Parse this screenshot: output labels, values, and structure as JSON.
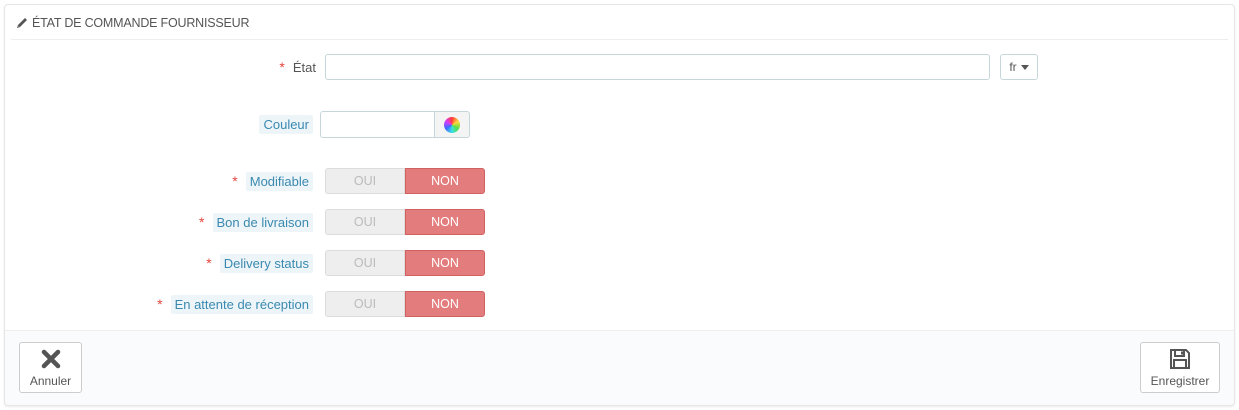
{
  "panel": {
    "title": "ÉTAT DE COMMANDE FOURNISSEUR",
    "title_icon": "pencil-icon"
  },
  "form": {
    "state": {
      "required_mark": "*",
      "label": "État",
      "value": "",
      "lang": "fr"
    },
    "color": {
      "label": "Couleur",
      "value": "",
      "picker_icon": "color-wheel-icon"
    },
    "toggles": [
      {
        "required_mark": "*",
        "label": "Modifiable",
        "yes": "OUI",
        "no": "NON",
        "selected": "NON"
      },
      {
        "required_mark": "*",
        "label": "Bon de livraison",
        "yes": "OUI",
        "no": "NON",
        "selected": "NON"
      },
      {
        "required_mark": "*",
        "label": "Delivery status",
        "yes": "OUI",
        "no": "NON",
        "selected": "NON"
      },
      {
        "required_mark": "*",
        "label": "En attente de réception",
        "yes": "OUI",
        "no": "NON",
        "selected": "NON"
      }
    ]
  },
  "footer": {
    "cancel": {
      "label": "Annuler",
      "icon": "close-icon"
    },
    "save": {
      "label": "Enregistrer",
      "icon": "save-icon"
    }
  },
  "colors": {
    "required": "#e3453d",
    "label_tip": "#3a89b0",
    "switch_off_active": "#e37c7c"
  }
}
